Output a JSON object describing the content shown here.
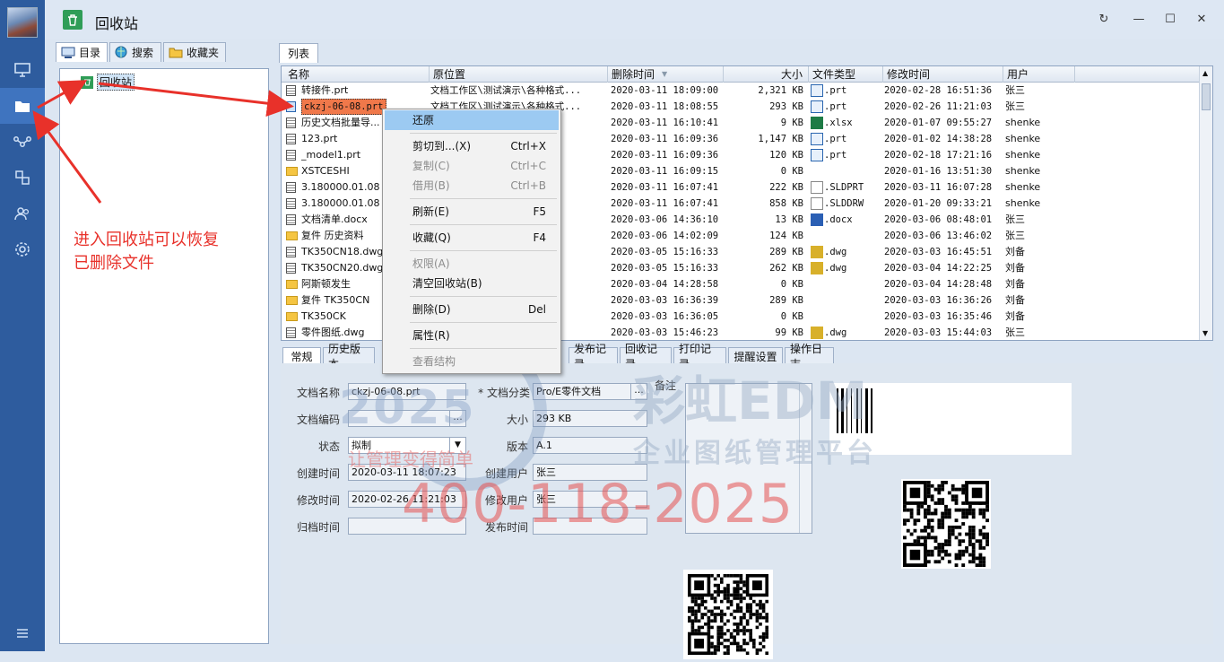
{
  "window": {
    "title": "回收站"
  },
  "left_panel": {
    "tabs": [
      "目录",
      "搜索",
      "收藏夹"
    ],
    "tree_root": "回收站"
  },
  "list_tab": "列表",
  "columns": [
    "名称",
    "原位置",
    "删除时间",
    "大小",
    "文件类型",
    "修改时间",
    "用户"
  ],
  "rows": [
    {
      "icon": "doc",
      "name": "转接件.prt",
      "loc": "文档工作区\\测试演示\\各种格式...",
      "del": "2020-03-11 18:09:00",
      "size": "2,321 KB",
      "ticon": "prt",
      "type": ".prt",
      "mod": "2020-02-28 16:51:36",
      "user": "张三"
    },
    {
      "icon": "part",
      "name": "ckzj-06-08.prt",
      "loc": "文档工作区\\测试演示\\各种格式...",
      "del": "2020-03-11 18:08:55",
      "size": "293 KB",
      "ticon": "prt",
      "type": ".prt",
      "mod": "2020-02-26 11:21:03",
      "user": "张三"
    },
    {
      "icon": "doc",
      "name": "历史文档批量导...",
      "loc": "格式...",
      "del": "2020-03-11 16:10:41",
      "size": "9 KB",
      "ticon": "xlsx",
      "type": ".xlsx",
      "mod": "2020-01-07 09:55:27",
      "user": "shenke"
    },
    {
      "icon": "doc",
      "name": "123.prt",
      "loc": "格式...",
      "del": "2020-03-11 16:09:36",
      "size": "1,147 KB",
      "ticon": "prt",
      "type": ".prt",
      "mod": "2020-01-02 14:38:28",
      "user": "shenke"
    },
    {
      "icon": "doc",
      "name": "_model1.prt",
      "loc": "格式...",
      "del": "2020-03-11 16:09:36",
      "size": "120 KB",
      "ticon": "prt",
      "type": ".prt",
      "mod": "2020-02-18 17:21:16",
      "user": "shenke"
    },
    {
      "icon": "folder",
      "name": "XSTCESHI",
      "loc": "格式...",
      "del": "2020-03-11 16:09:15",
      "size": "0 KB",
      "ticon": "",
      "type": "",
      "mod": "2020-01-16 13:51:30",
      "user": "shenke"
    },
    {
      "icon": "doc",
      "name": "3.180000.01.08",
      "loc": "格式...",
      "del": "2020-03-11 16:07:41",
      "size": "222 KB",
      "ticon": "sld",
      "type": ".SLDPRT",
      "mod": "2020-03-11 16:07:28",
      "user": "shenke"
    },
    {
      "icon": "doc",
      "name": "3.180000.01.08",
      "loc": "格式...",
      "del": "2020-03-11 16:07:41",
      "size": "858 KB",
      "ticon": "sld",
      "type": ".SLDDRW",
      "mod": "2020-01-20 09:33:21",
      "user": "shenke"
    },
    {
      "icon": "doc",
      "name": "文档清单.docx",
      "loc": "沟通...",
      "del": "2020-03-06 14:36:10",
      "size": "13 KB",
      "ticon": "docx",
      "type": ".docx",
      "mod": "2020-03-06 08:48:01",
      "user": "张三"
    },
    {
      "icon": "folder",
      "name": "复件 历史资料",
      "loc": "\\",
      "del": "2020-03-06 14:02:09",
      "size": "124 KB",
      "ticon": "",
      "type": "",
      "mod": "2020-03-06 13:46:02",
      "user": "张三"
    },
    {
      "icon": "doc",
      "name": "TK350CN18.dwg",
      "loc": "\\TK...",
      "del": "2020-03-05 15:16:33",
      "size": "289 KB",
      "ticon": "dwg",
      "type": ".dwg",
      "mod": "2020-03-03 16:45:51",
      "user": "刘备"
    },
    {
      "icon": "doc",
      "name": "TK350CN20.dwg",
      "loc": "\\TK...",
      "del": "2020-03-05 15:16:33",
      "size": "262 KB",
      "ticon": "dwg",
      "type": ".dwg",
      "mod": "2020-03-04 14:22:25",
      "user": "刘备"
    },
    {
      "icon": "folder",
      "name": "阿斯顿发生",
      "loc": "发生\\",
      "del": "2020-03-04 14:28:58",
      "size": "0 KB",
      "ticon": "",
      "type": "",
      "mod": "2020-03-04 14:28:48",
      "user": "刘备"
    },
    {
      "icon": "folder",
      "name": "复件 TK350CN",
      "loc": "\\TK...",
      "del": "2020-03-03 16:36:39",
      "size": "289 KB",
      "ticon": "",
      "type": "",
      "mod": "2020-03-03 16:36:26",
      "user": "刘备"
    },
    {
      "icon": "folder",
      "name": "TK350CK",
      "loc": "\\TK...",
      "del": "2020-03-03 16:36:05",
      "size": "0 KB",
      "ticon": "",
      "type": "",
      "mod": "2020-03-03 16:35:46",
      "user": "刘备"
    },
    {
      "icon": "doc",
      "name": "零件图纸.dwg",
      "loc": "\\...",
      "del": "2020-03-03 15:46:23",
      "size": "99 KB",
      "ticon": "dwg",
      "type": ".dwg",
      "mod": "2020-03-03 15:44:03",
      "user": "张三"
    }
  ],
  "context_menu": [
    {
      "label": "还原",
      "shortcut": "",
      "state": "highlight"
    },
    {
      "sep": true
    },
    {
      "label": "剪切到...(X)",
      "shortcut": "Ctrl+X",
      "state": "normal"
    },
    {
      "label": "复制(C)",
      "shortcut": "Ctrl+C",
      "state": "disabled"
    },
    {
      "label": "借用(B)",
      "shortcut": "Ctrl+B",
      "state": "disabled"
    },
    {
      "sep": true
    },
    {
      "label": "刷新(E)",
      "shortcut": "F5",
      "state": "normal"
    },
    {
      "sep": true
    },
    {
      "label": "收藏(Q)",
      "shortcut": "F4",
      "state": "normal"
    },
    {
      "sep": true
    },
    {
      "label": "权限(A)",
      "shortcut": "",
      "state": "disabled"
    },
    {
      "label": "清空回收站(B)",
      "shortcut": "",
      "state": "normal"
    },
    {
      "sep": true
    },
    {
      "label": "删除(D)",
      "shortcut": "Del",
      "state": "normal"
    },
    {
      "sep": true
    },
    {
      "label": "属性(R)",
      "shortcut": "",
      "state": "normal"
    },
    {
      "sep": true
    },
    {
      "label": "查看结构",
      "shortcut": "",
      "state": "disabled"
    }
  ],
  "detail_tabs": [
    "常规",
    "历史版本",
    "发布记录",
    "回收记录",
    "打印记录",
    "提醒设置",
    "操作日志"
  ],
  "detail": {
    "name_label": "文档名称",
    "name": "ckzj-06-08.prt",
    "category_label": "* 文档分类",
    "category": "Pro/E零件文档",
    "memo_label": "备注",
    "code_label": "文档编码",
    "code": "",
    "size_label": "大小",
    "size": "293 KB",
    "status_label": "状态",
    "status": "拟制",
    "version_label": "版本",
    "version": "A.1",
    "created_label": "创建时间",
    "created": "2020-03-11 18:07:23",
    "creator_label": "创建用户",
    "creator": "张三",
    "modified_label": "修改时间",
    "modified": "2020-02-26 11:21:03",
    "modifier_label": "修改用户",
    "modifier": "张三",
    "archived_label": "归档时间",
    "archived": "",
    "published_label": "发布时间",
    "published": ""
  },
  "watermark": {
    "year": "2025",
    "slogan": "让管理变得简单",
    "brand": "彩虹EDM",
    "sub": "企业图纸管理平台",
    "phone": "400-118-2025"
  },
  "annotation": {
    "line1": "进入回收站可以恢复",
    "line2": "已删除文件"
  },
  "colors": {
    "nav": "#2e5c9e",
    "selected_row": "#f0784a",
    "menu_highlight": "#9ccaf2",
    "annotation": "#e8312a"
  }
}
